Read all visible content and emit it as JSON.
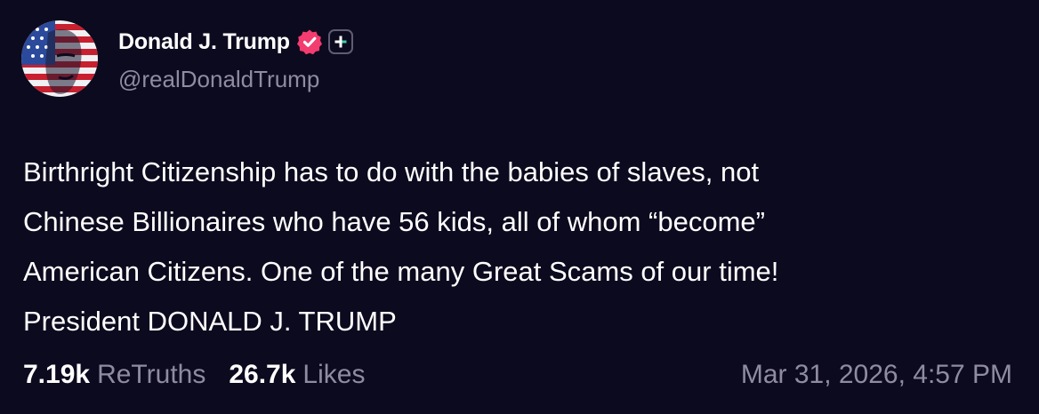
{
  "post": {
    "author": {
      "display_name": "Donald J. Trump",
      "handle": "@realDonaldTrump",
      "verified_icon": "verified-check-badge",
      "plus_icon": "plus-badge"
    },
    "body_lines": [
      "Birthright Citizenship has to do with the babies of slaves, not",
      "Chinese Billionaires who have 56 kids, all of whom “become”",
      "American Citizens. One of the many Great Scams of our time!",
      "President DONALD J. TRUMP"
    ],
    "stats": {
      "retruths_count": "7.19k",
      "retruths_label": "ReTruths",
      "likes_count": "26.7k",
      "likes_label": "Likes"
    },
    "timestamp": "Mar 31, 2026, 4:57 PM"
  },
  "colors": {
    "background": "#0c0a1e",
    "text": "#ffffff",
    "muted": "#8f8ca2",
    "verified_badge": "#f33c6f"
  }
}
